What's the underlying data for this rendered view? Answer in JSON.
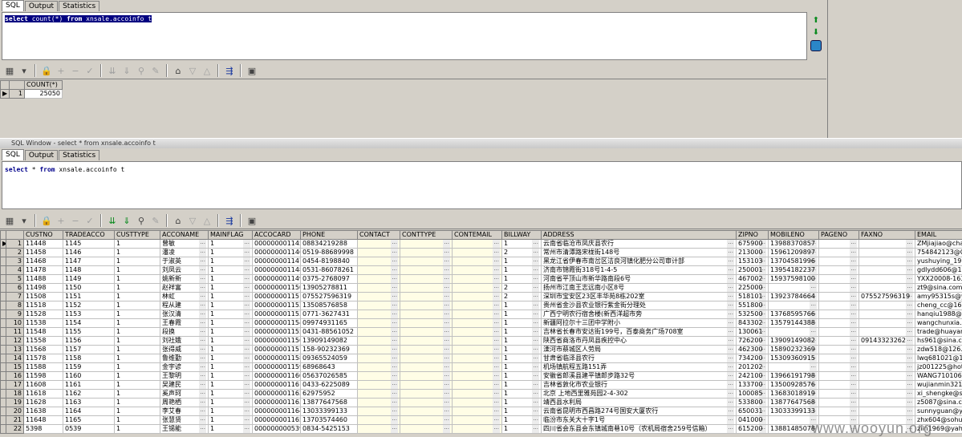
{
  "top_window": {
    "tabs": [
      "SQL",
      "Output",
      "Statistics"
    ],
    "sql": {
      "kw1": "select",
      "rest1": " count(*) ",
      "kw2": "from",
      "rest2": " xnsale.accoinfo t"
    },
    "grid": {
      "column": "COUNT(*)",
      "row_num": "1",
      "value": "25050"
    }
  },
  "bottom_window": {
    "title": "SQL Window - select * from xnsale.accoinfo t",
    "tabs": [
      "SQL",
      "Output",
      "Statistics"
    ],
    "sql": {
      "kw1": "select",
      "rest1": " * ",
      "kw2": "from",
      "rest2": " xnsale.accoinfo t"
    },
    "columns": [
      "CUSTNO",
      "TRADEACCO",
      "CUSTTYPE",
      "ACCONAME",
      "MAINFLAG",
      "ACCOCARD",
      "PHONE",
      "CONTACT",
      "CONTTYPE",
      "CONTEMAIL",
      "BILLWAY",
      "ADDRESS",
      "ZIPNO",
      "MOBILENO",
      "PAGENO",
      "FAXNO",
      "EMAIL"
    ],
    "rows": [
      [
        "1",
        "11448",
        "1145",
        "1",
        "曾敏",
        "1",
        "000000001145",
        "08834219288",
        "",
        "",
        "",
        "1",
        "云南省临沧市凤庆县农行",
        "675900",
        "13988370857",
        "",
        "",
        "ZMjiajiao@char"
      ],
      [
        "2",
        "11458",
        "1146",
        "1",
        "潘凌",
        "1",
        "000000001146",
        "0519-88689998",
        "",
        "",
        "",
        "2",
        "常州市清潭路宋栊街148号",
        "213000",
        "15961209897",
        "",
        "",
        "754842123@Q"
      ],
      [
        "3",
        "11468",
        "1147",
        "1",
        "于淑英",
        "1",
        "000000001147",
        "0454-8198840",
        "",
        "",
        "",
        "1",
        "黑龙江省伊春市南岔区洁良河镇化肥分公司审计部",
        "153103",
        "13704581996",
        "",
        "",
        "yushuying_196"
      ],
      [
        "4",
        "11478",
        "1148",
        "1",
        "刘凤云",
        "1",
        "000000001148",
        "0531-86078261",
        "",
        "",
        "",
        "1",
        "济南市锦霞街318号1-4-5",
        "250001",
        "13954182237",
        "",
        "",
        "gdlydd606@12"
      ],
      [
        "5",
        "11488",
        "1149",
        "1",
        "姚新新",
        "1",
        "000000001149",
        "0375-2768097",
        "",
        "",
        "",
        "1",
        "河南省平顶山市新华路南段6号",
        "467002",
        "15937598100",
        "",
        "",
        "YXX20008-163"
      ],
      [
        "6",
        "11498",
        "1150",
        "1",
        "赵祥富",
        "1",
        "000000001150",
        "13905278811",
        "",
        "",
        "",
        "2",
        "扬州市江南王志远南小区8号",
        "225000",
        "",
        "",
        "",
        "zt9@sina.com"
      ],
      [
        "7",
        "11508",
        "1151",
        "1",
        "林虹",
        "1",
        "000000001151",
        "075527596319",
        "",
        "",
        "",
        "2",
        "深圳市宝安区23区丰华苑8栋202室",
        "518101",
        "13923784664",
        "",
        "075527596319",
        "amy95315s@ya"
      ],
      [
        "8",
        "11518",
        "1152",
        "1",
        "程从建",
        "1",
        "000000001152",
        "13508576858",
        "",
        "",
        "",
        "1",
        "贵州省金沙县农业银行紫金街分理处",
        "551800",
        "",
        "",
        "",
        "cheng_cc@163"
      ],
      [
        "9",
        "11528",
        "1153",
        "1",
        "张汉清",
        "1",
        "000000001153",
        "0771-3627431",
        "",
        "",
        "",
        "1",
        "广西宁明农行宿舍楼(新西洋超市旁",
        "532500",
        "13768595766",
        "",
        "",
        "hanqiu1988@1"
      ],
      [
        "10",
        "11538",
        "1154",
        "1",
        "王春霞",
        "1",
        "000000001154",
        "09974931165",
        "",
        "",
        "",
        "1",
        "新疆阿拉尔十三团中学附小",
        "843302",
        "13579144388",
        "",
        "",
        "wangchunxia.2"
      ],
      [
        "11",
        "11548",
        "1155",
        "1",
        "段换",
        "1",
        "000000001155",
        "0431-88561052",
        "",
        "",
        "",
        "1",
        "吉林省长春市安达街199号，百泰商务广场708室",
        "130061",
        "",
        "",
        "",
        "trade@huayang"
      ],
      [
        "12",
        "11558",
        "1156",
        "1",
        "刘社娥",
        "1",
        "000000001156",
        "13909149082",
        "",
        "",
        "",
        "1",
        "陕西省商洛市丹凤县疾控中心",
        "726200",
        "13909149082",
        "",
        "09143323262",
        "hs961@sina.co"
      ],
      [
        "13",
        "11568",
        "1157",
        "1",
        "张得威",
        "1",
        "000000001157",
        "158-90232369",
        "",
        "",
        "",
        "1",
        "溧河市蔡城区人劳局",
        "462300",
        "15890232369",
        "",
        "",
        "zdw518@126.c"
      ],
      [
        "14",
        "11578",
        "1158",
        "1",
        "鲁维勤",
        "1",
        "000000001158",
        "09365524059",
        "",
        "",
        "",
        "1",
        "甘肃省临泽县农行",
        "734200",
        "15309360915",
        "",
        "",
        "lwq681021@16"
      ],
      [
        "15",
        "11588",
        "1159",
        "1",
        "金宇谚",
        "1",
        "000000001159",
        "68968643",
        "",
        "",
        "",
        "1",
        "机场镇航程五路151弄",
        "201202",
        "",
        "",
        "",
        "jz001225@hotm"
      ],
      [
        "16",
        "11598",
        "1160",
        "1",
        "王黎明",
        "1",
        "000000001160",
        "05637026585",
        "",
        "",
        "",
        "1",
        "安徽省郎溪县建平镇郎步路32号",
        "242100",
        "13966191798",
        "",
        "",
        "WANG710106"
      ],
      [
        "17",
        "11608",
        "1161",
        "1",
        "吴建民",
        "1",
        "000000001161",
        "0433-6225089",
        "",
        "",
        "",
        "1",
        "吉林省敦化市农业银行",
        "133700",
        "13500928576",
        "",
        "",
        "wujianmin321@"
      ],
      [
        "18",
        "11618",
        "1162",
        "1",
        "奚声珂",
        "1",
        "000000001162",
        "62975952",
        "",
        "",
        "",
        "1",
        "北京 上地西里雅苑园2-4-302",
        "100085",
        "13683018919",
        "",
        "",
        "xi_shengke@s"
      ],
      [
        "19",
        "11628",
        "1163",
        "1",
        "周艳栖",
        "1",
        "000000001163",
        "13877647568",
        "",
        "",
        "",
        "1",
        "靖西县水利局",
        "533800",
        "13877647568",
        "",
        "",
        "z5087@sina.c"
      ],
      [
        "20",
        "11638",
        "1164",
        "1",
        "李艾春",
        "1",
        "000000001164",
        "13033399133",
        "",
        "",
        "",
        "1",
        "云南省昆明市西昌路274号国安大厦农行",
        "650031",
        "13033399133",
        "",
        "",
        "sunnyguan@ya"
      ],
      [
        "21",
        "11648",
        "1165",
        "1",
        "张慧贤",
        "1",
        "000000001165",
        "13703574460",
        "",
        "",
        "",
        "1",
        "临汾市东关大十字1号",
        "041000",
        "",
        "",
        "",
        "zhx604@sohu.c"
      ],
      [
        "22",
        "5398",
        "0539",
        "1",
        "王锡能",
        "1",
        "000000000539",
        "0834-5425153",
        "",
        "",
        "",
        "1",
        "四川省会东县会东镇城南巷10号（农机局宿舍259号信箱）",
        "615200",
        "13881485078",
        "",
        "",
        "ziin1969@yaho"
      ]
    ]
  },
  "watermark": "www.wooyun.org",
  "colors": {
    "selection": "#000080",
    "keyword": "#00008b",
    "grid_readonly": "#fffde6"
  }
}
